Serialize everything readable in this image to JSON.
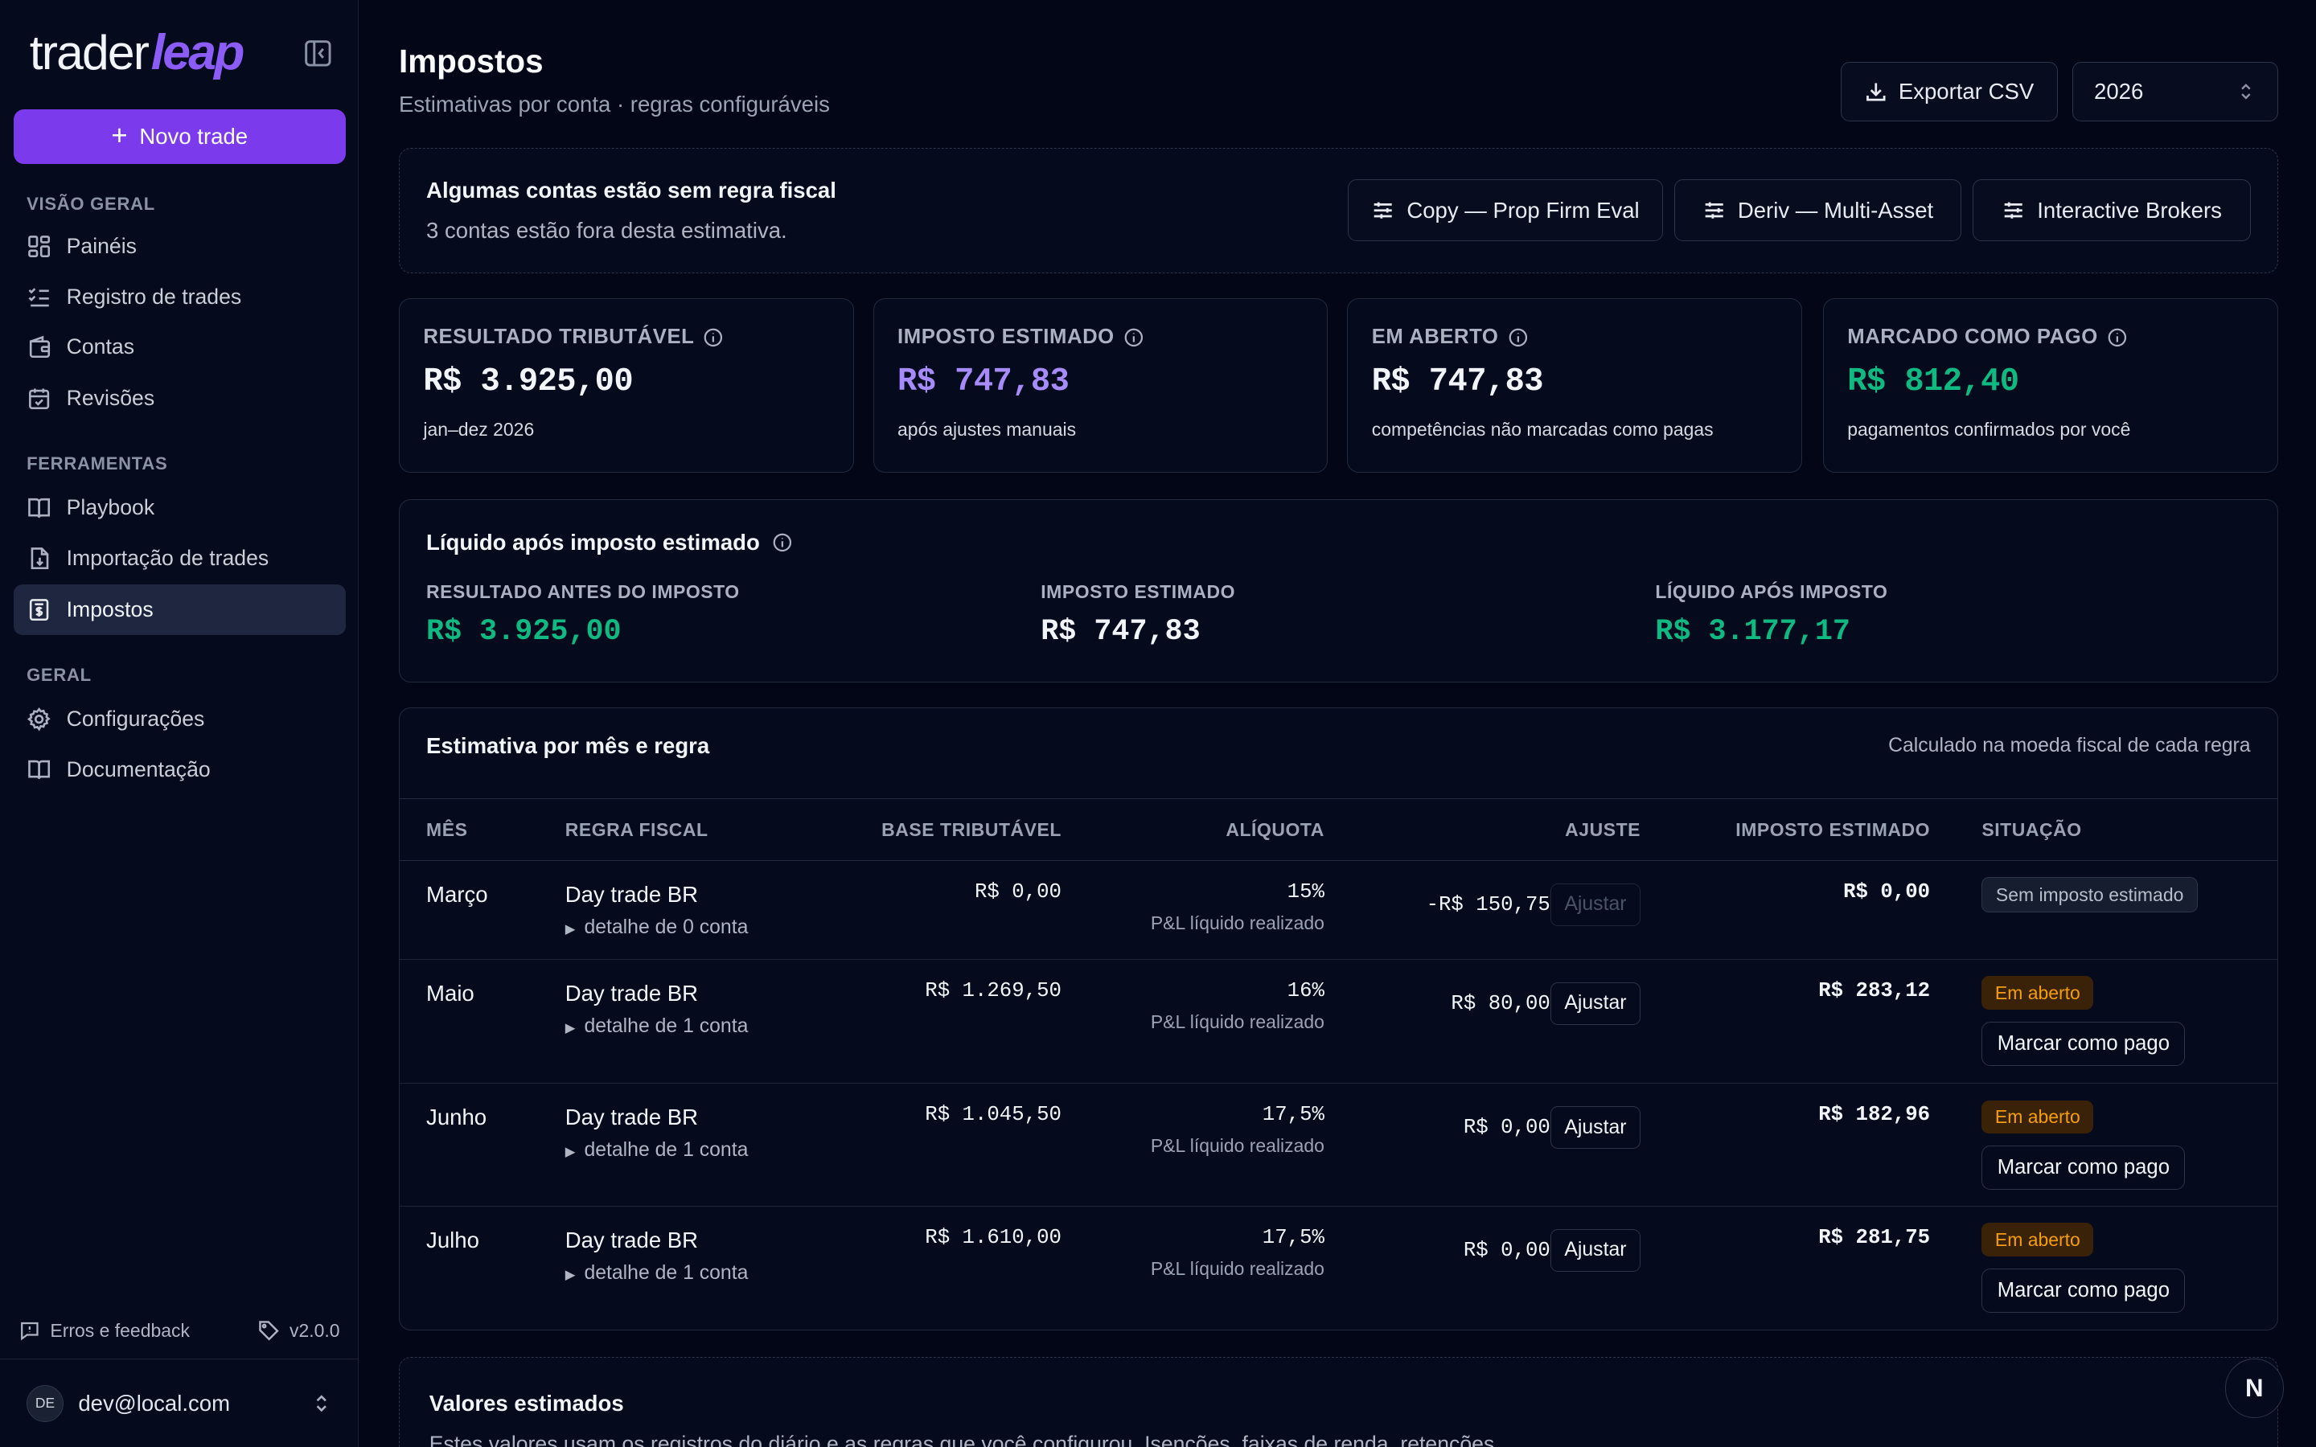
{
  "sidebar": {
    "logo_text": "trader",
    "logo_accent": "leap",
    "new_trade": "Novo trade",
    "sections": [
      "VISÃO GERAL",
      "FERRAMENTAS",
      "GERAL"
    ],
    "items": [
      {
        "label": "Painéis",
        "icon": "dashboard-icon"
      },
      {
        "label": "Registro de trades",
        "icon": "list-check-icon"
      },
      {
        "label": "Contas",
        "icon": "wallet-icon"
      },
      {
        "label": "Revisões",
        "icon": "calendar-check-icon"
      },
      {
        "label": "Playbook",
        "icon": "book-open-icon"
      },
      {
        "label": "Importação de trades",
        "icon": "file-import-icon"
      },
      {
        "label": "Impostos",
        "icon": "receipt-dollar-icon"
      },
      {
        "label": "Configurações",
        "icon": "gear-icon"
      },
      {
        "label": "Documentação",
        "icon": "book-icon"
      }
    ],
    "feedback": "Erros e feedback",
    "version": "v2.0.0",
    "user_initials": "DE",
    "user_email": "dev@local.com"
  },
  "header": {
    "title": "Impostos",
    "subtitle": "Estimativas por conta · regras configuráveis",
    "export": "Exportar CSV",
    "year": "2026"
  },
  "banner": {
    "title": "Algumas contas estão sem regra fiscal",
    "text": "3 contas estão fora desta estimativa.",
    "accounts": [
      "Copy — Prop Firm Eval",
      "Deriv — Multi-Asset",
      "Interactive Brokers"
    ]
  },
  "kpis": [
    {
      "label": "RESULTADO TRIBUTÁVEL",
      "value": "R$ 3.925,00",
      "sub": "jan–dez 2026",
      "color": "#f1f5f9"
    },
    {
      "label": "IMPOSTO ESTIMADO",
      "value": "R$ 747,83",
      "sub": "após ajustes manuais",
      "color": "#a78bfa"
    },
    {
      "label": "EM ABERTO",
      "value": "R$ 747,83",
      "sub": "competências não marcadas como pagas",
      "color": "#f1f5f9"
    },
    {
      "label": "MARCADO COMO PAGO",
      "value": "R$ 812,40",
      "sub": "pagamentos confirmados por você",
      "color": "#10b981"
    }
  ],
  "net": {
    "title": "Líquido após imposto estimado",
    "before_label": "RESULTADO ANTES DO IMPOSTO",
    "before_value": "R$ 3.925,00",
    "tax_label": "IMPOSTO ESTIMADO",
    "tax_value": "R$ 747,83",
    "after_label": "LÍQUIDO APÓS IMPOSTO",
    "after_value": "R$ 3.177,17"
  },
  "table": {
    "title": "Estimativa por mês e regra",
    "note": "Calculado na moeda fiscal de cada regra",
    "columns": [
      "MÊS",
      "REGRA FISCAL",
      "BASE TRIBUTÁVEL",
      "ALÍQUOTA",
      "AJUSTE",
      "IMPOSTO ESTIMADO",
      "SITUAÇÃO"
    ],
    "adjust_label": "Ajustar",
    "pay_label": "Marcar como pago",
    "rows": [
      {
        "month": "Março",
        "rule": "Day trade BR",
        "detail": "detalhe de 0 conta",
        "base": "R$ 0,00",
        "rate": "15%",
        "rate_basis": "P&L líquido realizado",
        "adjust": "-R$ 150,75",
        "tax": "R$ 0,00",
        "status": "Sem imposto estimado",
        "status_type": "none"
      },
      {
        "month": "Maio",
        "rule": "Day trade BR",
        "detail": "detalhe de 1 conta",
        "base": "R$ 1.269,50",
        "rate": "16%",
        "rate_basis": "P&L líquido realizado",
        "adjust": "R$ 80,00",
        "tax": "R$ 283,12",
        "status": "Em aberto",
        "status_type": "open"
      },
      {
        "month": "Junho",
        "rule": "Day trade BR",
        "detail": "detalhe de 1 conta",
        "base": "R$ 1.045,50",
        "rate": "17,5%",
        "rate_basis": "P&L líquido realizado",
        "adjust": "R$ 0,00",
        "tax": "R$ 182,96",
        "status": "Em aberto",
        "status_type": "open"
      },
      {
        "month": "Julho",
        "rule": "Day trade BR",
        "detail": "detalhe de 1 conta",
        "base": "R$ 1.610,00",
        "rate": "17,5%",
        "rate_basis": "P&L líquido realizado",
        "adjust": "R$ 0,00",
        "tax": "R$ 281,75",
        "status": "Em aberto",
        "status_type": "open"
      }
    ]
  },
  "estimated": {
    "title": "Valores estimados",
    "text": "Estes valores usam os registros do diário e as regras que você configurou. Isenções, faixas de renda, retenções"
  },
  "fab": "N"
}
